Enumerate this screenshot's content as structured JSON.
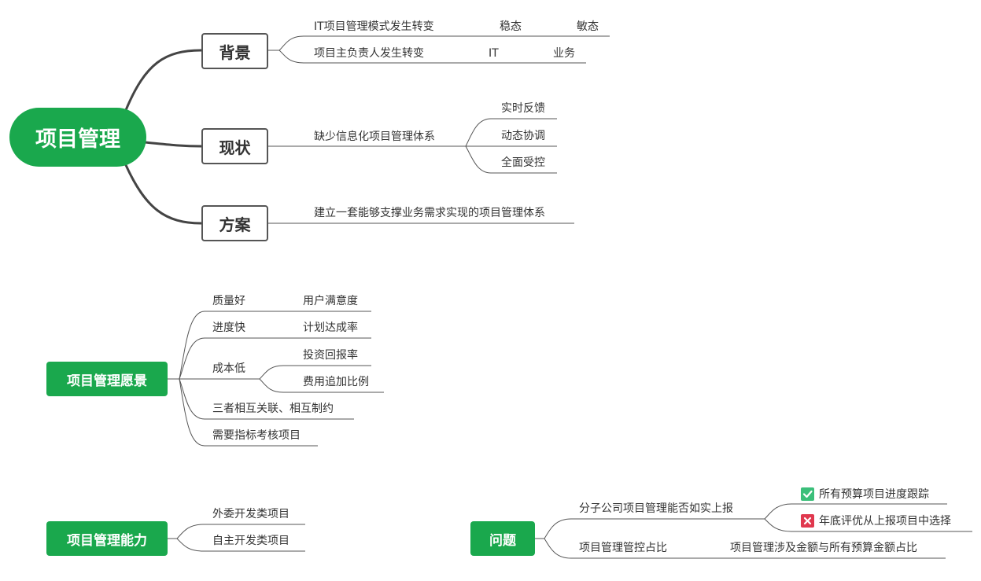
{
  "root": "项目管理",
  "branches": {
    "background": {
      "label": "背景",
      "items": [
        {
          "text": "IT项目管理模式发生转变",
          "from": "稳态",
          "to": "敏态"
        },
        {
          "text": "项目主负责人发生转变",
          "from": "IT",
          "to": "业务"
        }
      ]
    },
    "status": {
      "label": "现状",
      "item": "缺少信息化项目管理体系",
      "subs": [
        "实时反馈",
        "动态协调",
        "全面受控"
      ]
    },
    "plan": {
      "label": "方案",
      "item": "建立一套能够支撑业务需求实现的项目管理体系"
    }
  },
  "vision": {
    "title": "项目管理愿景",
    "quality": {
      "label": "质量好",
      "sub": "用户满意度"
    },
    "speed": {
      "label": "进度快",
      "sub": "计划达成率"
    },
    "cost": {
      "label": "成本低",
      "subs": [
        "投资回报率",
        "费用追加比例"
      ]
    },
    "relation": "三者相互关联、相互制约",
    "kpi": "需要指标考核项目"
  },
  "capability": {
    "title": "项目管理能力",
    "items": [
      "外委开发类项目",
      "自主开发类项目"
    ]
  },
  "issues": {
    "title": "问题",
    "report": {
      "label": "分子公司项目管理能否如实上报",
      "subs": [
        {
          "text": "所有预算项目进度跟踪",
          "icon": "check-icon",
          "color": "#3bbf7a"
        },
        {
          "text": "年底评优从上报项目中选择",
          "icon": "cross-icon",
          "color": "#e0384e"
        }
      ]
    },
    "ratio": {
      "label": "项目管理管控占比",
      "detail": "项目管理涉及金额与所有预算金额占比"
    }
  }
}
